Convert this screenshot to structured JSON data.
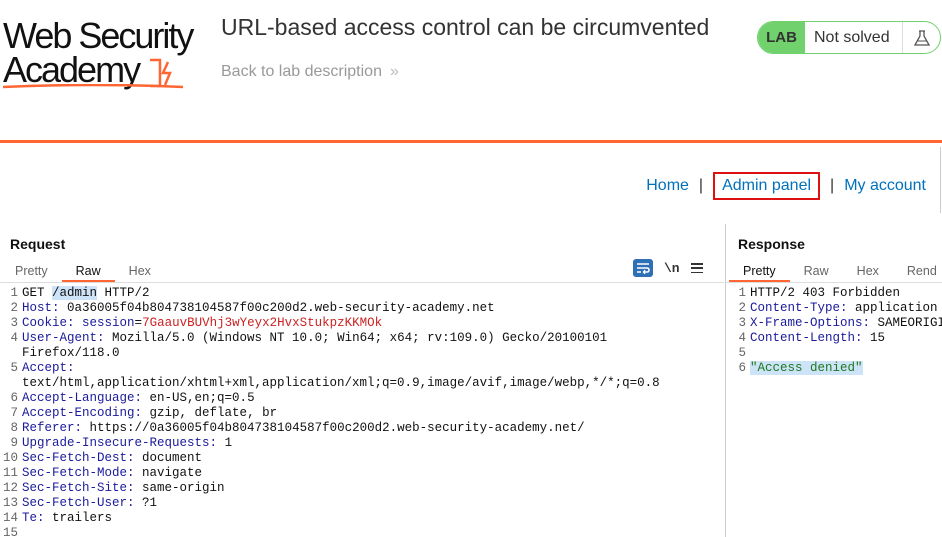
{
  "header": {
    "logo_line1": "Web Security",
    "logo_line2": "Academy",
    "lab_title": "URL-based access control can be circumvented",
    "back_link": "Back to lab description",
    "back_chevron": "»",
    "status_badge": "LAB",
    "status_text": "Not solved",
    "flask_icon": "flask-icon",
    "accent_color": "#ff6633",
    "badge_color": "#70d16d"
  },
  "nav": {
    "home": "Home",
    "admin_panel": "Admin panel",
    "my_account": "My account",
    "separator": "|"
  },
  "request": {
    "title": "Request",
    "tabs": [
      "Pretty",
      "Raw",
      "Hex"
    ],
    "active_tab": "Raw",
    "newline_label": "\\n",
    "lines": [
      {
        "n": "1",
        "text": "GET /admin HTTP/2"
      },
      {
        "n": "2",
        "key": "Host",
        "value": "0a36005f04b804738104587f00c200d2.web-security-academy.net"
      },
      {
        "n": "3",
        "key": "Cookie",
        "value": "session=7GaauvBUVhj3wYeyx2HvxStukpzKKMOk"
      },
      {
        "n": "4",
        "key": "User-Agent",
        "value": "Mozilla/5.0 (Windows NT 10.0; Win64; x64; rv:109.0) Gecko/20100101"
      },
      {
        "n": "",
        "text": "Firefox/118.0"
      },
      {
        "n": "5",
        "key": "Accept",
        "value": ""
      },
      {
        "n": "",
        "text": "text/html,application/xhtml+xml,application/xml;q=0.9,image/avif,image/webp,*/*;q=0.8"
      },
      {
        "n": "6",
        "key": "Accept-Language",
        "value": "en-US,en;q=0.5"
      },
      {
        "n": "7",
        "key": "Accept-Encoding",
        "value": "gzip, deflate, br"
      },
      {
        "n": "8",
        "key": "Referer",
        "value": "https://0a36005f04b804738104587f00c200d2.web-security-academy.net/"
      },
      {
        "n": "9",
        "key": "Upgrade-Insecure-Requests",
        "value": "1"
      },
      {
        "n": "10",
        "key": "Sec-Fetch-Dest",
        "value": "document"
      },
      {
        "n": "11",
        "key": "Sec-Fetch-Mode",
        "value": "navigate"
      },
      {
        "n": "12",
        "key": "Sec-Fetch-Site",
        "value": "same-origin"
      },
      {
        "n": "13",
        "key": "Sec-Fetch-User",
        "value": "?1"
      },
      {
        "n": "14",
        "key": "Te",
        "value": "trailers"
      },
      {
        "n": "15",
        "text": ""
      }
    ]
  },
  "response": {
    "title": "Response",
    "tabs": [
      "Pretty",
      "Raw",
      "Hex",
      "Rend"
    ],
    "active_tab": "Pretty",
    "lines": [
      {
        "n": "1",
        "text": "HTTP/2 403 Forbidden"
      },
      {
        "n": "2",
        "key": "Content-Type",
        "value": "application"
      },
      {
        "n": "3",
        "key": "X-Frame-Options",
        "value": "SAMEORIGIN"
      },
      {
        "n": "4",
        "key": "Content-Length",
        "value": "15"
      },
      {
        "n": "5",
        "text": ""
      },
      {
        "n": "6",
        "text": "\"Access denied\""
      }
    ]
  }
}
